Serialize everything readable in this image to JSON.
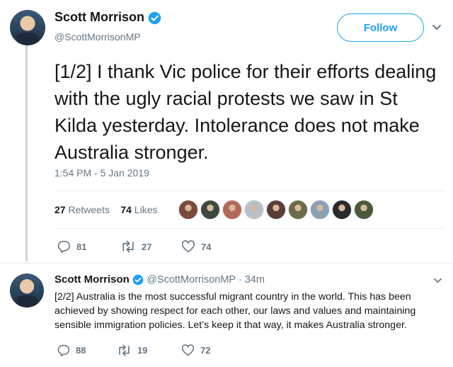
{
  "tweet": {
    "author_name": "Scott Morrison",
    "author_handle": "@ScottMorrisonMP",
    "follow_label": "Follow",
    "text": "[1/2] I thank Vic police for their efforts dealing with the ugly racial protests we saw in St Kilda yesterday. Intolerance does not make Australia stronger.",
    "timestamp": "1:54 PM - 5 Jan 2019",
    "retweets_count": "27",
    "retweets_label": "Retweets",
    "likes_count": "74",
    "likes_label": "Likes",
    "actions": {
      "replies": "81",
      "retweets": "27",
      "likes": "74"
    },
    "likers": [
      {
        "color": "#7a4a3a"
      },
      {
        "color": "#3d4a3f"
      },
      {
        "color": "#b46a5a"
      },
      {
        "color": "#b8c0c8"
      },
      {
        "color": "#5a3e36"
      },
      {
        "color": "#6b6a4a"
      },
      {
        "color": "#8aa0b4"
      },
      {
        "color": "#2a2a2a"
      },
      {
        "color": "#4a5a3a"
      }
    ]
  },
  "reply": {
    "author_name": "Scott Morrison",
    "author_handle": "@ScottMorrisonMP",
    "time": "· 34m",
    "text": "[2/2] Australia is the most successful migrant country in the world. This has been achieved by showing respect for each other, our laws and values and maintaining sensible immigration policies. Let’s keep it that way, it makes Australia stronger.",
    "actions": {
      "replies": "88",
      "retweets": "19",
      "likes": "72"
    }
  },
  "colors": {
    "accent": "#1da1f2",
    "secondary_text": "#657786",
    "primary_text": "#14171a",
    "divider": "#e6ecf0"
  },
  "icons": [
    "verified-icon",
    "chevron-down-icon",
    "reply-icon",
    "retweet-icon",
    "like-icon"
  ]
}
